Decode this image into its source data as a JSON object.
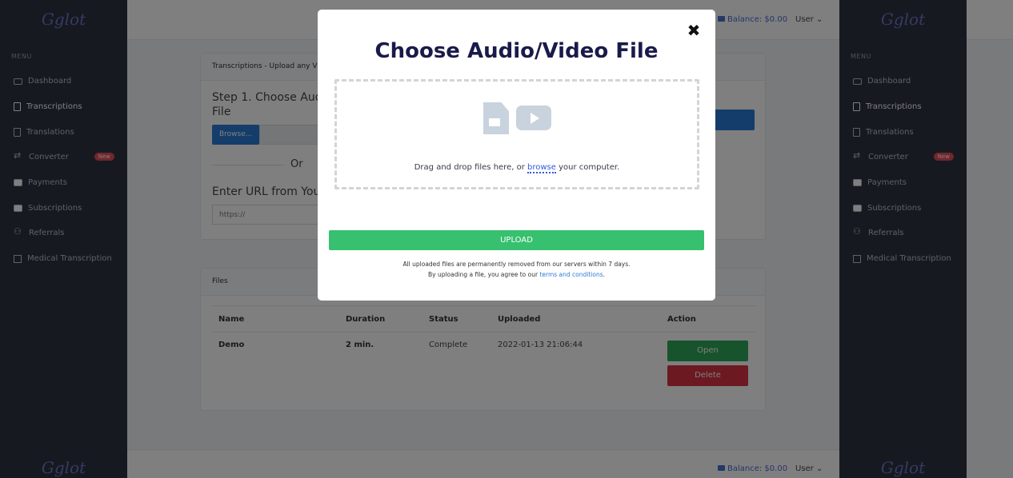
{
  "app": {
    "logo": "Gglot"
  },
  "sidebar": {
    "menu_label": "MENU",
    "items": [
      {
        "label": "Dashboard",
        "icon": "monitor-icon"
      },
      {
        "label": "Transcriptions",
        "icon": "document-icon",
        "active": true
      },
      {
        "label": "Translations",
        "icon": "document-icon"
      },
      {
        "label": "Converter",
        "icon": "swap-icon",
        "badge": "New"
      },
      {
        "label": "Payments",
        "icon": "credit-card-icon"
      },
      {
        "label": "Subscriptions",
        "icon": "credit-card-icon"
      },
      {
        "label": "Referrals",
        "icon": "users-icon"
      },
      {
        "label": "Medical Transcription",
        "icon": "external-link-icon"
      }
    ]
  },
  "header": {
    "balance": "Balance: $0.00",
    "user": "User ⌄"
  },
  "upload_card": {
    "heading": "Transcriptions - Upload any V",
    "step1": "Step 1. Choose Aud File",
    "browse_label": "Browse...",
    "or": "Or",
    "url_title": "Enter URL from You",
    "url_placeholder": "https://"
  },
  "files_card": {
    "heading": "Files",
    "columns": [
      "Name",
      "Duration",
      "Status",
      "Uploaded",
      "Action"
    ],
    "rows": [
      {
        "name": "Demo",
        "duration": "2 min.",
        "status": "Complete",
        "uploaded": "2022-01-13 21:06:44",
        "open": "Open",
        "delete": "Delete"
      }
    ]
  },
  "modal": {
    "close": "✖",
    "title": "Choose Audio/Video File",
    "drop_prefix": "Drag and drop files here, or ",
    "drop_link": "browse",
    "drop_suffix": " your computer.",
    "upload": "UPLOAD",
    "note1": "All uploaded files are permanently removed from our servers within 7 days.",
    "note2_prefix": "By uploading a file, you agree to our ",
    "note2_link": "terms and conditions",
    "note2_suffix": "."
  },
  "colors": {
    "sidebar_bg": "#2c3440",
    "accent_blue": "#2b7bd6",
    "upload_green": "#36c06f",
    "open_green": "#2fa85a",
    "delete_red": "#d83342",
    "badge_red": "#e84c5a",
    "logo_purple": "#6d73c9"
  }
}
